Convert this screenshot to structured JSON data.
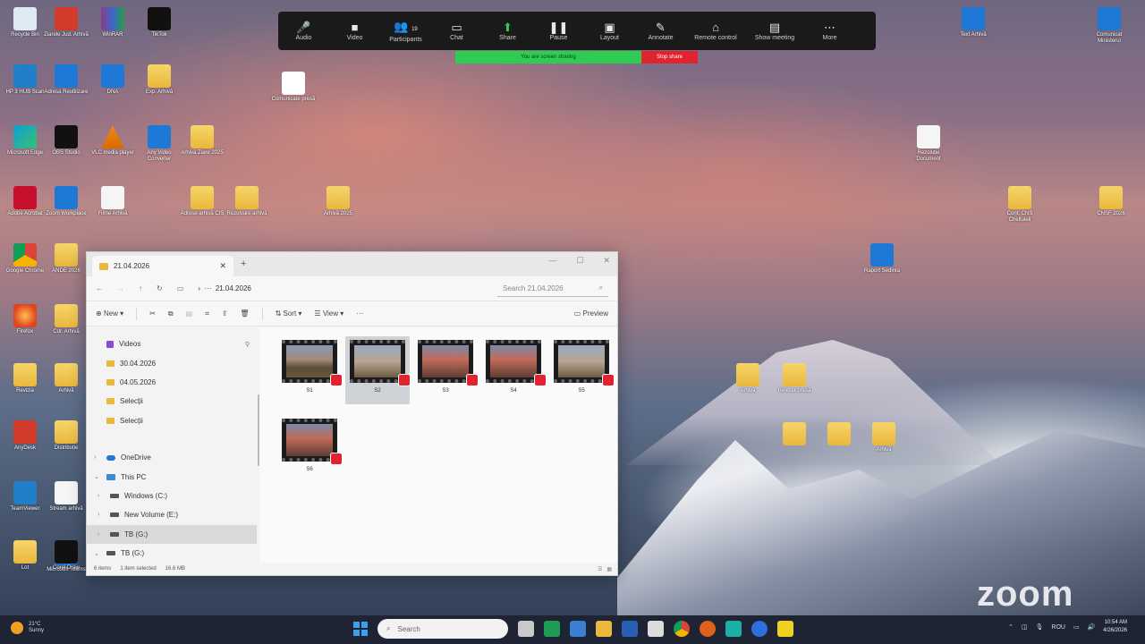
{
  "desktop": {
    "left_icons": [
      {
        "label": "Recycle Bin",
        "icon": "recycle-bin-icon"
      },
      {
        "label": "Ziarele Jud. Arhivă",
        "icon": "shortcut-icon"
      },
      {
        "label": "WinRAR",
        "icon": "winrar-icon"
      },
      {
        "label": "TikTok",
        "icon": "tiktok-icon"
      },
      {
        "label": "HP 3 HUB Scan",
        "icon": "scanner-icon"
      },
      {
        "label": "Adresa Reutilizare",
        "icon": "network-icon"
      },
      {
        "label": "DNA",
        "icon": "dna-icon"
      },
      {
        "label": "Exp. Arhivă",
        "icon": "folder-icon"
      },
      {
        "label": "Microsoft Edge",
        "icon": "edge-icon"
      },
      {
        "label": "OBS Studio",
        "icon": "obs-icon"
      },
      {
        "label": "VLC media player",
        "icon": "vlc-icon"
      },
      {
        "label": "Any Video Converter",
        "icon": "converter-icon"
      },
      {
        "label": "Arhivă Ziare 2025",
        "icon": "folder-icon"
      },
      {
        "label": "Adobe Acrobat",
        "icon": "pdf-icon"
      },
      {
        "label": "Zoom Workplace",
        "icon": "zoom-icon"
      },
      {
        "label": "Filme Arhivă",
        "icon": "document-icon"
      },
      {
        "label": "Adrese arhivă CIS",
        "icon": "folder-icon"
      },
      {
        "label": "Rezolvare arhivă",
        "icon": "folder-icon"
      },
      {
        "label": "Arhivă 2025",
        "icon": "folder-icon"
      },
      {
        "label": "Google Chrome",
        "icon": "chrome-icon"
      },
      {
        "label": "ANDE 2026",
        "icon": "folder-icon"
      },
      {
        "label": "Firefox",
        "icon": "firefox-icon"
      },
      {
        "label": "Cdr. Arhivă",
        "icon": "folder-icon"
      },
      {
        "label": "Revizia",
        "icon": "folder-icon"
      },
      {
        "label": "Arhivă",
        "icon": "folder-icon"
      },
      {
        "label": "AnyDesk",
        "icon": "anydesk-icon"
      },
      {
        "label": "Distribuție",
        "icon": "folder-icon"
      },
      {
        "label": "TeamViewer",
        "icon": "teamviewer-icon"
      },
      {
        "label": "Stream arhivă",
        "icon": "document-icon"
      },
      {
        "label": "Microsoft Teams",
        "icon": "teams-icon"
      },
      {
        "label": "Lot",
        "icon": "folder-icon"
      },
      {
        "label": "Corel Draw",
        "icon": "pen-icon"
      },
      {
        "label": "Filme Selecții",
        "icon": "folder-icon"
      },
      {
        "label": "Comunicate presă",
        "icon": "white-file-icon"
      }
    ],
    "right_icons": [
      {
        "label": "Text Arhivă",
        "icon": "word-icon"
      },
      {
        "label": "Comunicat Ministerul",
        "icon": "word-icon"
      },
      {
        "label": "Rezoluție Document",
        "icon": "document-icon"
      },
      {
        "label": "Cont. CNS Cheltuieli",
        "icon": "folder-icon"
      },
      {
        "label": "CNSF 2026",
        "icon": "folder-icon"
      },
      {
        "label": "Raport Sedinta",
        "icon": "word-icon"
      },
      {
        "label": "Arhivă",
        "icon": "folder-icon"
      },
      {
        "label": "Revista presă",
        "icon": "folder-icon"
      },
      {
        "label": "",
        "icon": "folder-icon"
      },
      {
        "label": "",
        "icon": "folder-icon"
      },
      {
        "label": "Arhivă",
        "icon": "folder-icon"
      }
    ],
    "watermark": "zoom"
  },
  "zoom_toolbar": {
    "buttons": [
      {
        "label": "Audio",
        "icon": "microphone-icon"
      },
      {
        "label": "Video",
        "icon": "video-icon"
      },
      {
        "label": "Participants",
        "icon": "participants-icon",
        "count": "19"
      },
      {
        "label": "Chat",
        "icon": "chat-icon"
      },
      {
        "label": "Share",
        "icon": "share-icon"
      },
      {
        "label": "Pause",
        "icon": "pause-icon"
      },
      {
        "label": "Layout",
        "icon": "layout-icon"
      },
      {
        "label": "Annotate",
        "icon": "pencil-icon"
      },
      {
        "label": "Remote control",
        "icon": "mouse-icon"
      },
      {
        "label": "Show meeting",
        "icon": "window-icon"
      },
      {
        "label": "More",
        "icon": "more-icon"
      }
    ],
    "sharing_text": "You are screen sharing",
    "stop_share": "Stop share"
  },
  "explorer": {
    "tab_title": "21.04.2026",
    "address": "21.04.2026",
    "search_placeholder": "Search 21.04.2026",
    "commands": {
      "new": "New",
      "sort": "Sort",
      "view": "View",
      "more": "···",
      "preview": "Preview"
    },
    "nav": [
      {
        "label": "Videos",
        "icon": "videos-icon",
        "indent": 0,
        "pinned": true
      },
      {
        "label": "30.04.2026",
        "icon": "folder-icon",
        "indent": 0
      },
      {
        "label": "04.05.2026",
        "icon": "folder-icon",
        "indent": 0
      },
      {
        "label": "Selecții",
        "icon": "folder-icon",
        "indent": 0
      },
      {
        "label": "Selecții",
        "icon": "folder-icon",
        "indent": 0
      },
      {
        "label": "OneDrive",
        "icon": "onedrive-icon",
        "indent": 0,
        "expandable": true
      },
      {
        "label": "This PC",
        "icon": "pc-icon",
        "indent": 0,
        "expanded": true
      },
      {
        "label": "Windows (C:)",
        "icon": "drive-icon",
        "indent": 1,
        "expandable": true
      },
      {
        "label": "New Volume (E:)",
        "icon": "drive-icon",
        "indent": 1,
        "expandable": true
      },
      {
        "label": "TB (G:)",
        "icon": "drive-icon",
        "indent": 1,
        "expandable": true,
        "selected": true
      },
      {
        "label": "TB (G:)",
        "icon": "drive-icon",
        "indent": 0,
        "expanded": true
      }
    ],
    "files": [
      {
        "name": "S1",
        "selected": false
      },
      {
        "name": "S2",
        "selected": true
      },
      {
        "name": "S3",
        "selected": false
      },
      {
        "name": "S4",
        "selected": false
      },
      {
        "name": "S5",
        "selected": false
      },
      {
        "name": "S6",
        "selected": false
      }
    ],
    "status": {
      "items": "6 items",
      "selected": "1 item selected",
      "size": "16.6 MB"
    }
  },
  "taskbar": {
    "weather": {
      "temp": "21°C",
      "condition": "Sunny"
    },
    "search_placeholder": "Search",
    "language": "ROU",
    "time": "10:54 AM",
    "date": "4/26/2026"
  }
}
